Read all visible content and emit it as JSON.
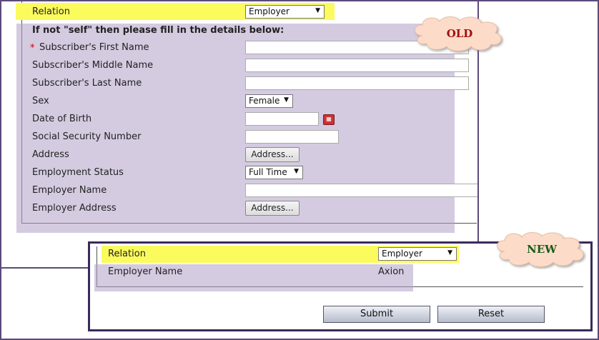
{
  "old_form": {
    "callout": "OLD",
    "relation_label": "Relation",
    "relation_value": "Employer",
    "instruction": "If not \"self\" then please fill in the details below:",
    "required_marker": "*",
    "fields": {
      "first_name": "Subscriber's First Name",
      "middle_name": "Subscriber's Middle Name",
      "last_name": "Subscriber's Last Name",
      "sex": "Sex",
      "sex_value": "Female",
      "dob": "Date of Birth",
      "ssn": "Social Security Number",
      "address": "Address",
      "address_button": "Address...",
      "employment_status": "Employment Status",
      "employment_status_value": "Full Time",
      "employer_name": "Employer Name",
      "employer_address": "Employer Address",
      "employer_address_button": "Address..."
    }
  },
  "new_form": {
    "callout": "NEW",
    "relation_label": "Relation",
    "relation_value": "Employer",
    "employer_name_label": "Employer Name",
    "employer_name_value": "Axion",
    "submit_label": "Submit",
    "reset_label": "Reset"
  },
  "icons": {
    "calendar": "calendar-icon",
    "dropdown": "chevron-down-icon"
  },
  "colors": {
    "highlight": "#fbfb5e",
    "overlay": "#b0a0c8",
    "callout_text": "#a01010",
    "frame": "#5a4a7a"
  }
}
